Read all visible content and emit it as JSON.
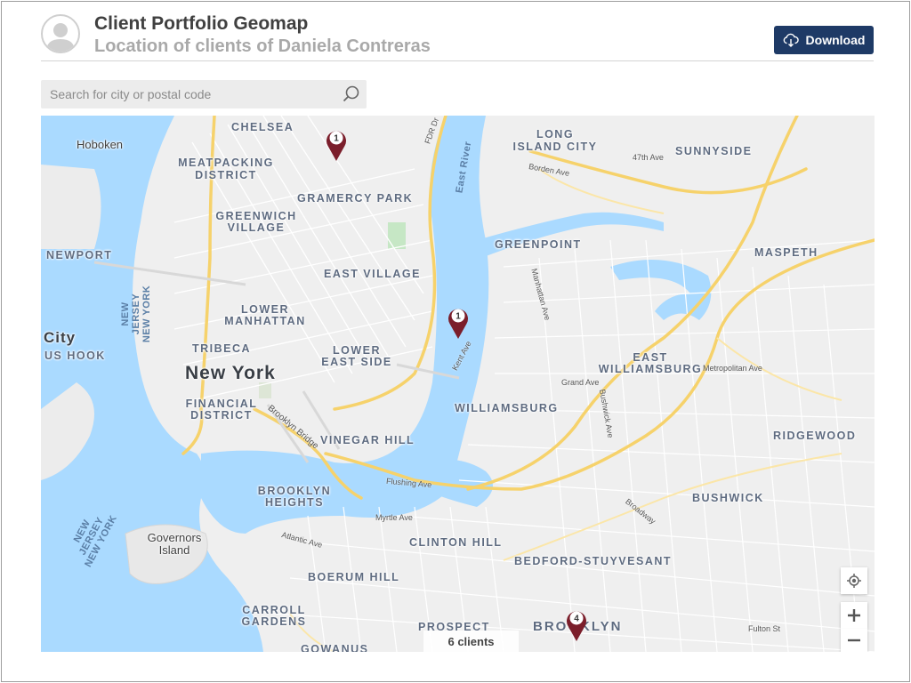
{
  "header": {
    "title": "Client Portfolio Geomap",
    "subtitle": "Location of clients of Daniela Contreras",
    "download_label": "Download"
  },
  "search": {
    "placeholder": "Search for city or postal code",
    "value": ""
  },
  "map": {
    "client_count_label": "6 clients",
    "markers": [
      {
        "count": "1",
        "location": "Gramercy"
      },
      {
        "count": "1",
        "location": "Williamsburg"
      },
      {
        "count": "4",
        "location": "Brooklyn"
      }
    ],
    "city_labels": [
      "New York",
      "City",
      "BROOKLYN",
      "LONG ISLAND CITY"
    ],
    "neighborhoods": [
      "CHELSEA",
      "MEATPACKING DISTRICT",
      "GRAMERCY PARK",
      "GREENWICH VILLAGE",
      "EAST VILLAGE",
      "LOWER MANHATTAN",
      "TRIBECA",
      "LOWER EAST SIDE",
      "FINANCIAL DISTRICT",
      "VINEGAR HILL",
      "BROOKLYN HEIGHTS",
      "CLINTON HILL",
      "BOERUM HILL",
      "CARROLL GARDENS",
      "GOWANUS",
      "PROSPECT",
      "GREENPOINT",
      "WILLIAMSBURG",
      "EAST WILLIAMSBURG",
      "SUNNYSIDE",
      "MASPETH",
      "RIDGEWOOD",
      "BUSHWICK",
      "BEDFORD-STUYVESANT",
      "NEWPORT",
      "US HOOK"
    ],
    "poi": [
      "Hoboken",
      "Governors Island"
    ],
    "water": [
      "East River",
      "NEW JERSEY NEW YORK"
    ],
    "streets": [
      "Brooklyn Bridge",
      "FDR Dr",
      "Kent Ave",
      "Flushing Ave",
      "Myrtle Ave",
      "Atlantic Ave",
      "Fulton St",
      "Metropolitan Ave",
      "Grand Ave",
      "Borden Ave",
      "47th Ave",
      "Manhattan Ave",
      "Bushwick Ave",
      "Broadway"
    ],
    "colors": {
      "water": "#aadaff",
      "land": "#eeeeee",
      "highway": "#f6d26b",
      "marker": "#7b1e2b",
      "accent": "#1e3a66"
    }
  }
}
